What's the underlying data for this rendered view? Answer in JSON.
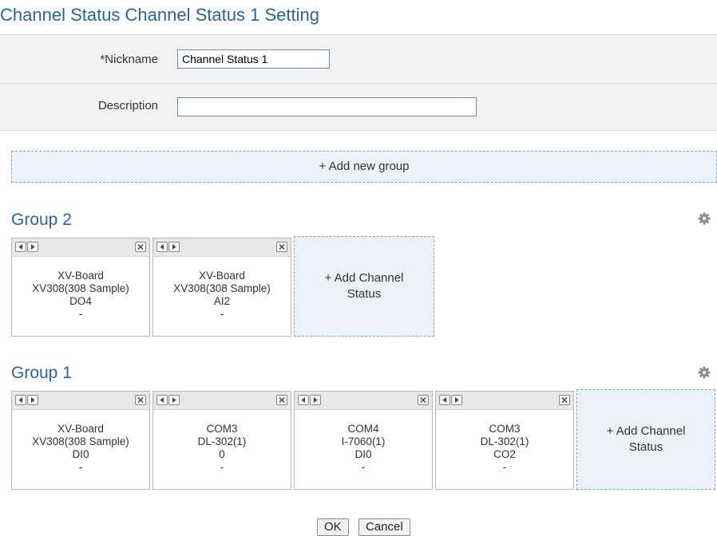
{
  "title": "Channel Status Channel Status 1 Setting",
  "form": {
    "nickname_label": "*Nickname",
    "nickname_value": "Channel Status 1",
    "description_label": "Description",
    "description_value": ""
  },
  "add_group_label": "+ Add new group",
  "groups": [
    {
      "name": "Group 2",
      "cards": [
        {
          "lines": [
            "XV-Board",
            "XV308(308 Sample)",
            "DO4",
            "-"
          ]
        },
        {
          "lines": [
            "XV-Board",
            "XV308(308 Sample)",
            "AI2",
            "-"
          ]
        }
      ],
      "add_label_1": "+ Add Channel",
      "add_label_2": "Status"
    },
    {
      "name": "Group 1",
      "cards": [
        {
          "lines": [
            "XV-Board",
            "XV308(308 Sample)",
            "DI0",
            "-"
          ]
        },
        {
          "lines": [
            "COM3",
            "DL-302(1)",
            "0",
            "-"
          ]
        },
        {
          "lines": [
            "COM4",
            "I-7060(1)",
            "DI0",
            "-"
          ]
        },
        {
          "lines": [
            "COM3",
            "DL-302(1)",
            "CO2",
            "-"
          ]
        }
      ],
      "add_label_1": "+ Add Channel",
      "add_label_2": "Status"
    }
  ],
  "buttons": {
    "ok": "OK",
    "cancel": "Cancel"
  },
  "icons": {
    "gear": "gear-icon",
    "left": "arrow-left-icon",
    "right": "arrow-right-icon",
    "close": "close-icon"
  },
  "colors": {
    "accent": "#2a6496",
    "panel": "#ebf1f7",
    "dashed_border": "#7fa5cf"
  }
}
